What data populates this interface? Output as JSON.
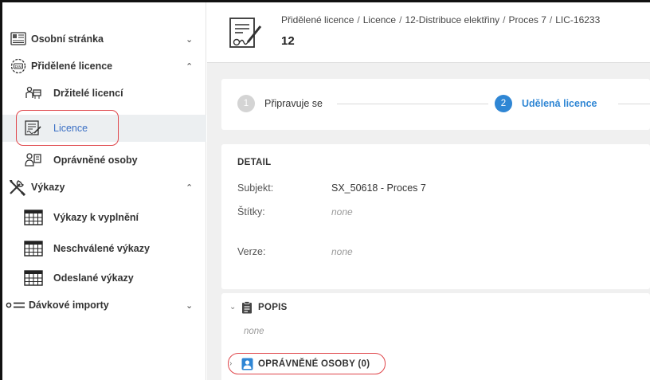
{
  "sidebar": {
    "items": [
      {
        "label": "Osobní stránka",
        "icon": "profile-icon",
        "chevron": "⌄"
      },
      {
        "label": "Přidělené licence",
        "icon": "license-badge-icon",
        "chevron": "⌃"
      },
      {
        "label": "Držitelé licencí",
        "icon": "license-holders-icon"
      },
      {
        "label": "Licence",
        "icon": "license-document-icon"
      },
      {
        "label": "Oprávněné osoby",
        "icon": "authorized-persons-icon"
      },
      {
        "label": "Výkazy",
        "icon": "tools-icon",
        "chevron": "⌃"
      },
      {
        "label": "Výkazy k vyplnění",
        "icon": "table-icon"
      },
      {
        "label": "Neschválené výkazy",
        "icon": "table-icon"
      },
      {
        "label": "Odeslané výkazy",
        "icon": "table-icon"
      },
      {
        "label": "Dávkové importy",
        "icon": "import-list-icon",
        "chevron": "⌄"
      }
    ]
  },
  "header": {
    "breadcrumb": [
      "Přidělené licence",
      "Licence",
      "12-Distribuce elektřiny",
      "Proces 7",
      "LIC-16233"
    ],
    "title": "12"
  },
  "stepper": {
    "steps": [
      {
        "num": "1",
        "label": "Připravuje se"
      },
      {
        "num": "2",
        "label": "Udělená licence"
      }
    ]
  },
  "detail": {
    "title": "DETAIL",
    "rows": [
      {
        "key": "Subjekt:",
        "value": "SX_50618 - Proces 7"
      },
      {
        "key": "Štítky:",
        "value": "none"
      },
      {
        "key": "Verze:",
        "value": "none"
      }
    ]
  },
  "popis": {
    "title": "POPIS",
    "value": "none",
    "authorized_title": "OPRÁVNĚNÉ OSOBY (0)"
  },
  "colors": {
    "accent": "#2f86d4",
    "highlight": "#e0464b",
    "sidebar_active_bg": "#eceff1",
    "main_bg": "#f0f0f0"
  }
}
